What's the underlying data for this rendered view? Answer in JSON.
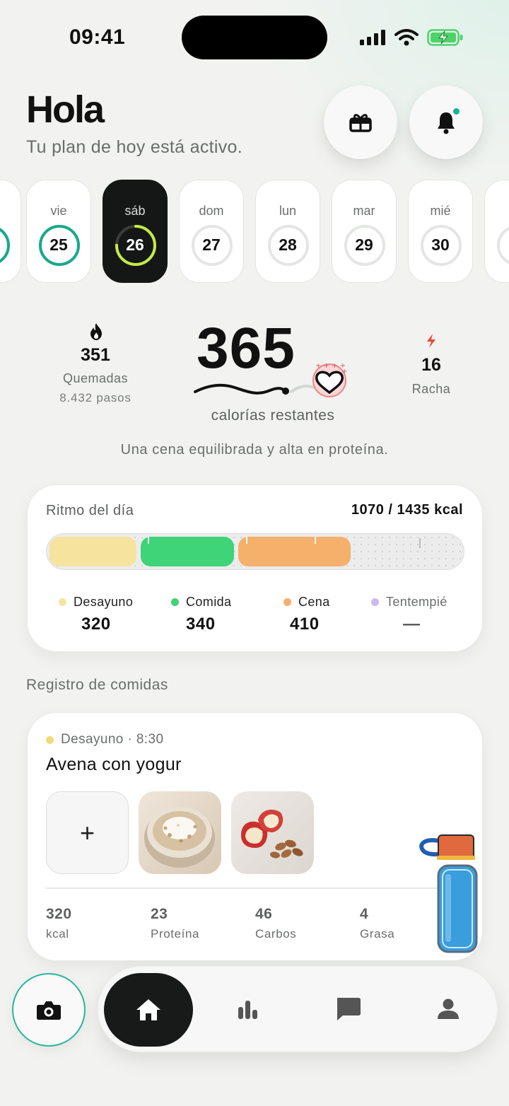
{
  "status_bar": {
    "time": "09:41",
    "icons": [
      "signal-icon",
      "wifi-icon",
      "battery-charging-icon"
    ]
  },
  "header": {
    "greeting": "Hola",
    "subtitle": "Tu plan de hoy está activo.",
    "buttons": [
      "gift-icon",
      "bell-icon"
    ]
  },
  "days": [
    {
      "label": "vie",
      "num": "25",
      "progress": 1.0,
      "ring_color": "#1aa88c"
    },
    {
      "label": "sáb",
      "num": "26",
      "progress": 0.75,
      "ring_color": "#c7ea45",
      "active": true
    },
    {
      "label": "dom",
      "num": "27",
      "progress": 0
    },
    {
      "label": "lun",
      "num": "28",
      "progress": 0
    },
    {
      "label": "mar",
      "num": "29",
      "progress": 0
    },
    {
      "label": "mié",
      "num": "30",
      "progress": 0
    }
  ],
  "summary": {
    "burned_value": "351",
    "burned_label": "Quemadas",
    "steps": "8.432 pasos",
    "calories_remaining": "365",
    "calories_label": "calorías restantes",
    "streak_value": "16",
    "streak_label": "Racha",
    "tagline": "Una cena equilibrada y alta en proteína."
  },
  "rhythm": {
    "title": "Ritmo del día",
    "total": "1070 / 1435 kcal",
    "consumed": 1070,
    "goal": 1435,
    "legend": [
      {
        "label": "Desayuno",
        "value": "320",
        "color": "#f6e39e"
      },
      {
        "label": "Comida",
        "value": "340",
        "color": "#3fd477"
      },
      {
        "label": "Cena",
        "value": "410",
        "color": "#f5b06b"
      },
      {
        "label": "Tentempié",
        "value": "—",
        "color": "#cdb9ef"
      }
    ]
  },
  "meals": {
    "section_title": "Registro de comidas",
    "entry": {
      "meta": "Desayuno · 8:30",
      "name": "Avena con yogur",
      "add_label": "+",
      "macros": [
        {
          "value": "320",
          "label": "kcal"
        },
        {
          "value": "23",
          "label": "Proteína"
        },
        {
          "value": "46",
          "label": "Carbos"
        },
        {
          "value": "4",
          "label": "Grasa"
        }
      ]
    }
  },
  "nav": {
    "items": [
      "camera-icon",
      "home-icon",
      "stats-icon",
      "chat-icon",
      "profile-icon"
    ],
    "active": "home-icon"
  }
}
